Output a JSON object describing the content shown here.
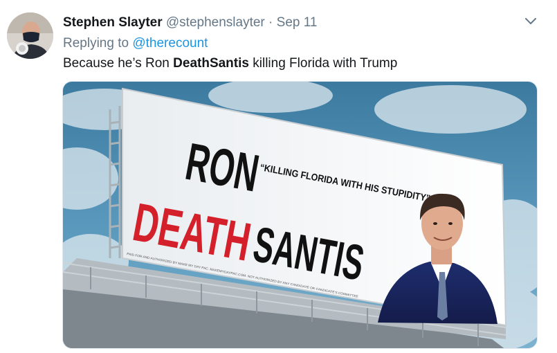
{
  "tweet": {
    "author_name": "Stephen Slayter",
    "handle": "@stephenslayter",
    "separator": "·",
    "date": "Sep 11",
    "reply_prefix": "Replying to",
    "reply_to": "@therecount",
    "text_before": "Because he’s Ron ",
    "text_bold": "DeathSantis",
    "text_after": " killing Florida with Trump"
  },
  "media": {
    "billboard": {
      "line_ron": "RON",
      "line_death": "DEATH",
      "line_santis": "SANTIS",
      "quote": "“KILLING FLORIDA WITH HIS STUPIDITY”",
      "disclaimer_left": "PAID FOR AND AUTHORIZED BY MAKE MY DAY PAC. MAKEMYDAYPAC.COM. NOT AUTHORIZED BY ANY CANDIDATE OR CANDIDATE'S COMMITTEE"
    }
  },
  "colors": {
    "name": "#14171a",
    "secondary": "#657786",
    "link": "#1b95e0",
    "billboard_red": "#d4202a",
    "billboard_black": "#111111",
    "sky": "#4f8fb0"
  },
  "icons": {
    "caret": "chevron-down-icon",
    "avatar": "user-avatar"
  }
}
